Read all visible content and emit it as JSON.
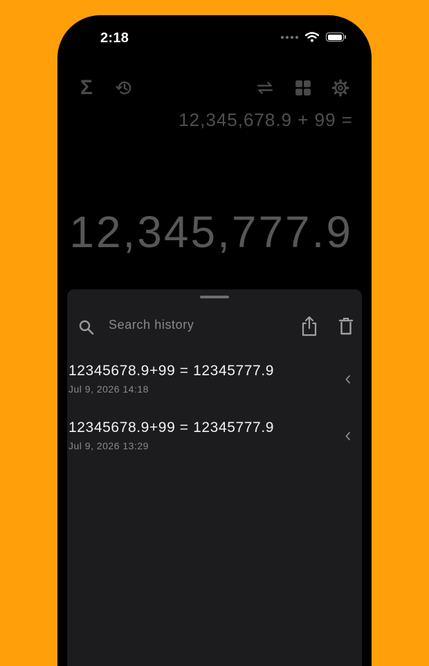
{
  "status_bar": {
    "time": "2:18"
  },
  "toolbar": {
    "sigma_symbol": "Σ",
    "icons": [
      "sigma-icon",
      "history-icon",
      "swap-icon",
      "grid-icon",
      "gear-icon"
    ]
  },
  "display": {
    "expression": "12,345,678.9 + 99 =",
    "result": "12,345,777.9"
  },
  "history_panel": {
    "search_placeholder": "Search history",
    "items": [
      {
        "expression": "12345678.9+99 = 12345777.9",
        "date": "Jul 9, 2026 14:18"
      },
      {
        "expression": "12345678.9+99 = 12345777.9",
        "date": "Jul 9, 2026 13:29"
      }
    ]
  },
  "colors": {
    "background": "#FFA00A",
    "phone": "#000000",
    "sheet": "#1C1C1E",
    "icon_dim": "#4A4A4A"
  }
}
